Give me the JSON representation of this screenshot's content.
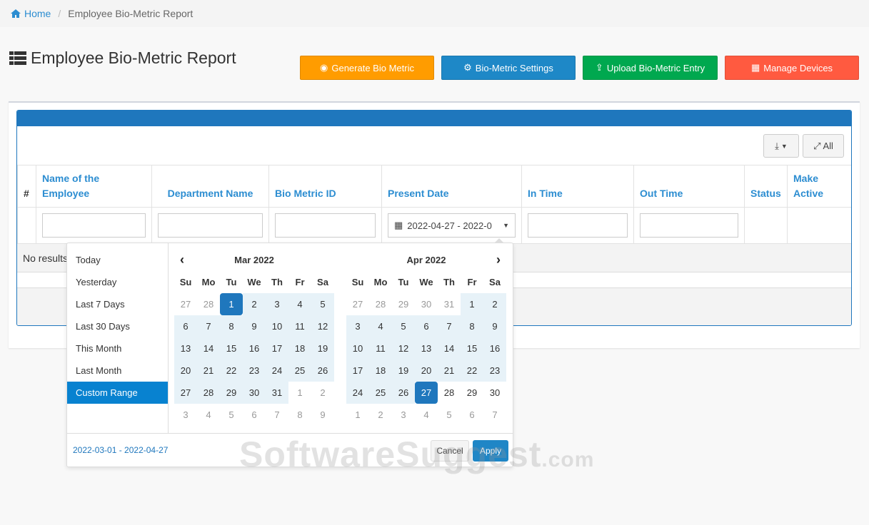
{
  "breadcrumb": {
    "home": "Home",
    "current": "Employee Bio-Metric Report"
  },
  "page_title": "Employee Bio-Metric Report",
  "buttons": [
    {
      "label": "Generate Bio Metric",
      "color": "#ff9c00",
      "icon": "fingerprint-icon"
    },
    {
      "label": "Bio-Metric Settings",
      "color": "#1e88c7",
      "icon": "cogs-icon"
    },
    {
      "label": "Upload Bio-Metric Entry",
      "color": "#00a84f",
      "icon": "upload-icon"
    },
    {
      "label": "Manage Devices",
      "color": "#ff5a40",
      "icon": "calculator-icon"
    }
  ],
  "toolbar": {
    "export_icon": "export-icon",
    "expand_label": "All"
  },
  "table": {
    "columns": [
      "#",
      "Name of the Employee",
      "Department Name",
      "Bio Metric ID",
      "Present Date",
      "In Time",
      "Out Time",
      "Status",
      "Make Active"
    ],
    "date_filter": "2022-04-27 - 2022-0",
    "no_results": "No results"
  },
  "datepicker": {
    "ranges": [
      "Today",
      "Yesterday",
      "Last 7 Days",
      "Last 30 Days",
      "This Month",
      "Last Month",
      "Custom Range"
    ],
    "active_range": "Custom Range",
    "dow": [
      "Su",
      "Mo",
      "Tu",
      "We",
      "Th",
      "Fr",
      "Sa"
    ],
    "calendars": [
      {
        "title": "Mar 2022",
        "weeks": [
          [
            27,
            28,
            1,
            2,
            3,
            4,
            5
          ],
          [
            6,
            7,
            8,
            9,
            10,
            11,
            12
          ],
          [
            13,
            14,
            15,
            16,
            17,
            18,
            19
          ],
          [
            20,
            21,
            22,
            23,
            24,
            25,
            26
          ],
          [
            27,
            28,
            29,
            30,
            31,
            1,
            2
          ],
          [
            3,
            4,
            5,
            6,
            7,
            8,
            9
          ]
        ]
      },
      {
        "title": "Apr 2022",
        "weeks": [
          [
            27,
            28,
            29,
            30,
            31,
            1,
            2
          ],
          [
            3,
            4,
            5,
            6,
            7,
            8,
            9
          ],
          [
            10,
            11,
            12,
            13,
            14,
            15,
            16
          ],
          [
            17,
            18,
            19,
            20,
            21,
            22,
            23
          ],
          [
            24,
            25,
            26,
            27,
            28,
            29,
            30
          ],
          [
            1,
            2,
            3,
            4,
            5,
            6,
            7
          ]
        ]
      }
    ],
    "start_date": "2022-03-01",
    "end_date": "2022-04-27",
    "selected_text": "2022-03-01 - 2022-04-27",
    "cancel": "Cancel",
    "apply": "Apply"
  },
  "watermark": {
    "main": "SoftwareSuggest",
    "suffix": ".com"
  }
}
